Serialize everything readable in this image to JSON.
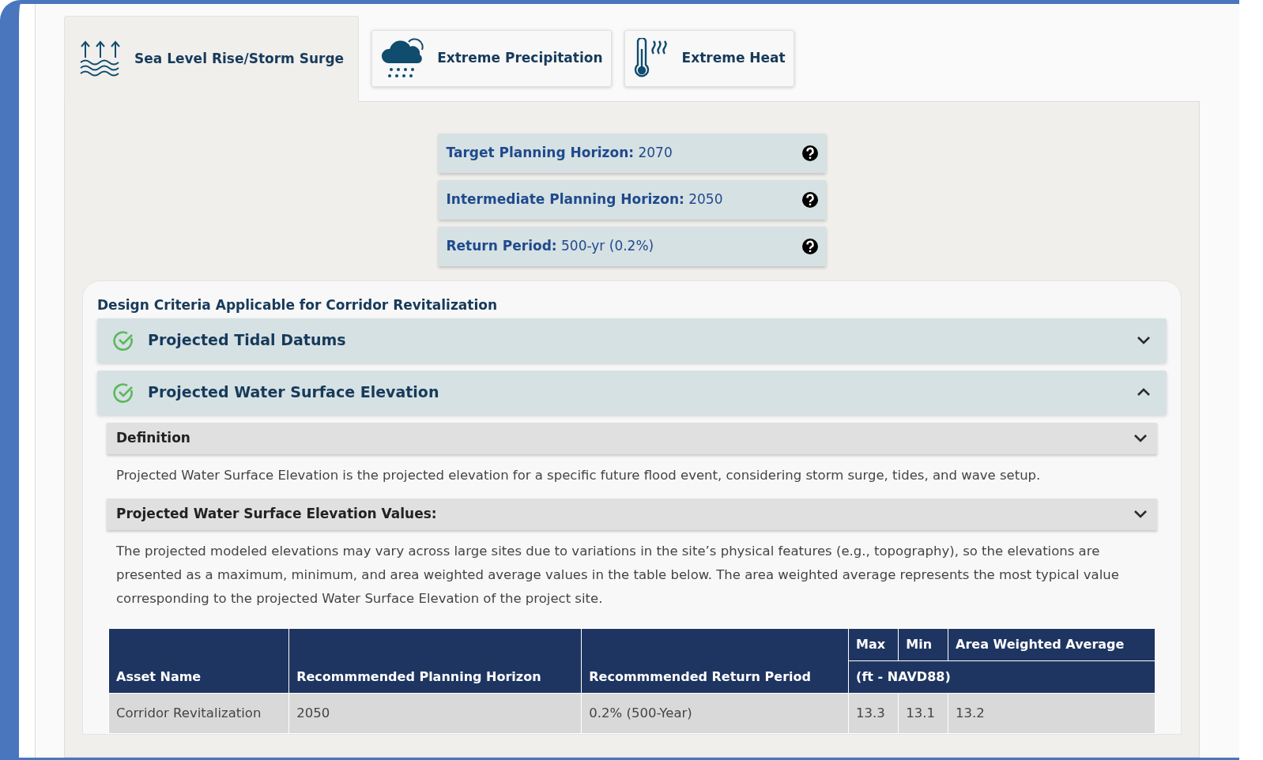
{
  "tabs": [
    {
      "label": "Sea Level Rise/Storm Surge",
      "kind": "waves",
      "selected": true
    },
    {
      "label": "Extreme Precipitation",
      "kind": "rain",
      "selected": false
    },
    {
      "label": "Extreme Heat",
      "kind": "heat",
      "selected": false
    }
  ],
  "horizon_items": [
    {
      "label": "Target Planning Horizon:",
      "value": "2070"
    },
    {
      "label": "Intermediate Planning Horizon:",
      "value": "2050"
    },
    {
      "label": "Return Period:",
      "value": "500-yr (0.2%)"
    }
  ],
  "criteria": {
    "title": "Design Criteria Applicable for Corridor Revitalization",
    "accordions": [
      {
        "title": "Projected Tidal Datums",
        "checked": true,
        "expanded": false
      },
      {
        "title": "Projected Water Surface Elevation",
        "checked": true,
        "expanded": true,
        "sections": [
          {
            "title": "Definition",
            "text": "Projected Water Surface Elevation is the projected elevation for a specific future flood event, considering storm surge, tides, and wave setup."
          },
          {
            "title": "Projected Water Surface Elevation Values:",
            "text": "The projected modeled elevations may vary across large sites due to variations in the site’s physical features (e.g., topography), so the elevations are presented as a maximum, minimum, and area weighted average values in the table below. The area weighted average represents the most typical value corresponding to the projected Water Surface Elevation of the project site."
          }
        ],
        "table": {
          "columns": [
            "Asset Name",
            "Recommmended Planning Horizon",
            "Recommmended Return Period"
          ],
          "value_columns": [
            "Max",
            "Min",
            "Area Weighted Average"
          ],
          "unit": "(ft - NAVD88)",
          "rows": [
            [
              "Corridor Revitalization",
              "2050",
              "0.2% (500-Year)",
              "13.3",
              "13.1",
              "13.2"
            ]
          ]
        }
      }
    ]
  }
}
